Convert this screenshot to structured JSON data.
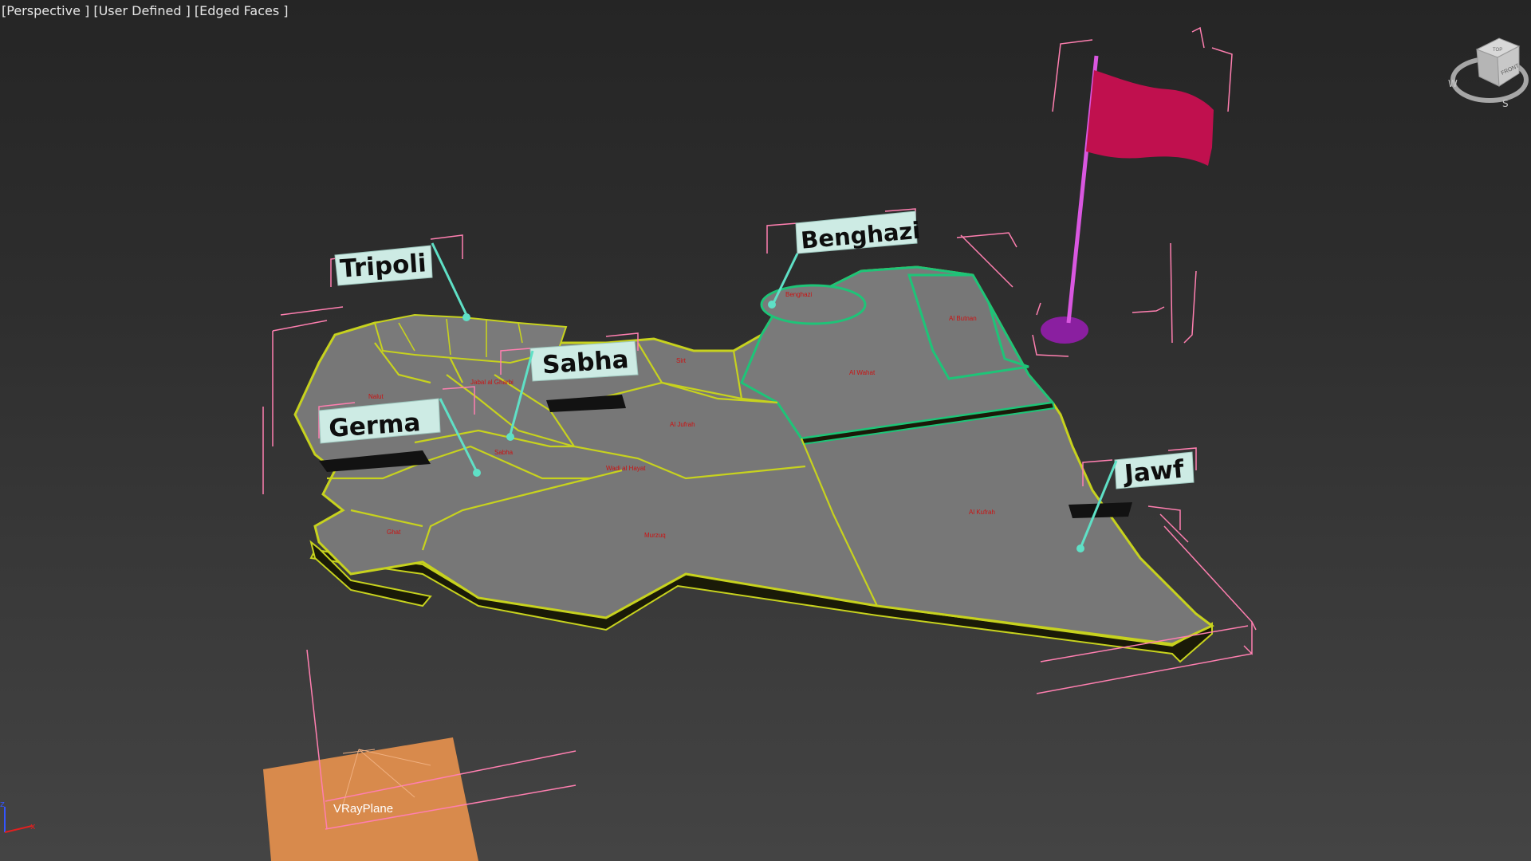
{
  "viewport": {
    "label": "[Perspective ] [User Defined ] [Edged Faces ]"
  },
  "city_labels": {
    "tripoli": "Tripoli",
    "benghazi": "Benghazi",
    "sabha": "Sabha",
    "germa": "Germa",
    "jawf": "Jawf"
  },
  "vray_plane": {
    "name": "VRayPlane"
  },
  "axis_tripod": {
    "z": "z",
    "x": "x"
  },
  "viewcube": {
    "face_top": "TOP",
    "face_front": "FRONT",
    "west": "W",
    "south": "S"
  },
  "colors": {
    "background": "#2e2e2e",
    "map_surface": "#777777",
    "map_edge_yellow": "#c7d21e",
    "map_edge_green": "#1ec478",
    "region_text": "#cc1111",
    "label_plate": "#cdebe4",
    "pin_line": "#5fe0c6",
    "selection_bracket": "#ff7fb0",
    "flag": "#c0104e",
    "flag_pole": "#d957e0",
    "flag_base": "#8a1fa0",
    "vray_plane": "#d88a4c"
  }
}
